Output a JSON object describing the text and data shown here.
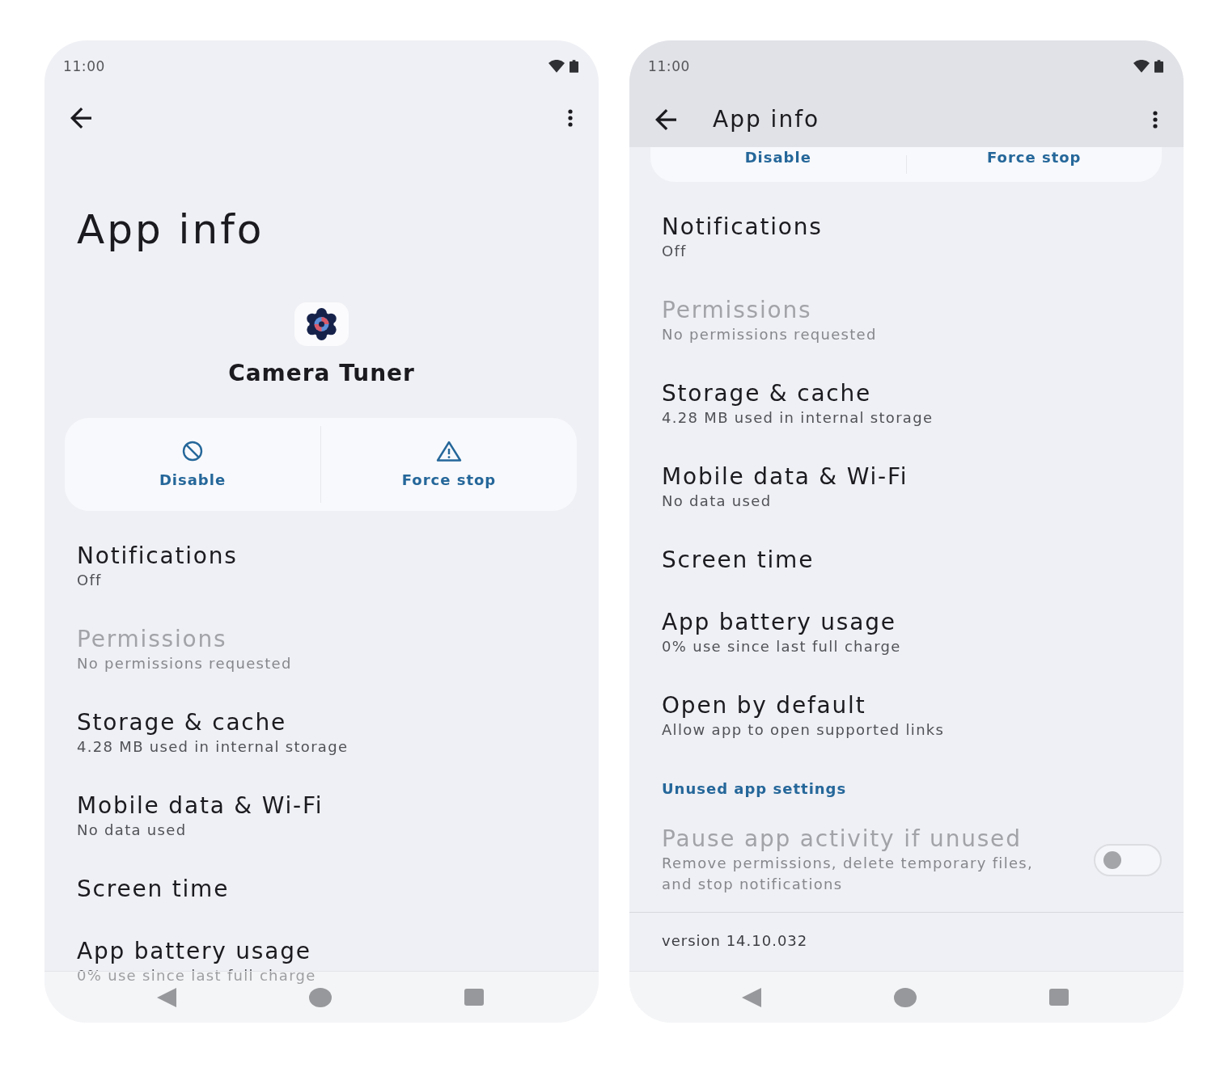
{
  "screens": [
    {
      "status_bar": {
        "time": "11:00"
      },
      "app_bar": {
        "kind": "large",
        "title": "App info"
      },
      "app": {
        "name": "Camera Tuner"
      },
      "actions": [
        {
          "label": "Disable"
        },
        {
          "label": "Force stop"
        }
      ],
      "rows": [
        {
          "kind": "item",
          "title": "Notifications",
          "summary": "Off",
          "disabled": false
        },
        {
          "kind": "item",
          "title": "Permissions",
          "summary": "No permissions requested",
          "disabled": true
        },
        {
          "kind": "item",
          "title": "Storage & cache",
          "summary": "4.28 MB used in internal storage",
          "disabled": false
        },
        {
          "kind": "item",
          "title": "Mobile data & Wi-Fi",
          "summary": "No data used",
          "disabled": false
        },
        {
          "kind": "item",
          "title": "Screen time",
          "disabled": false
        },
        {
          "kind": "item",
          "title": "App battery usage",
          "summary": "0% use since last full charge",
          "disabled": false
        }
      ]
    },
    {
      "status_bar": {
        "time": "11:00"
      },
      "app_bar": {
        "kind": "collapsed",
        "title": "App info"
      },
      "actions": [
        {
          "label": "Disable"
        },
        {
          "label": "Force stop"
        }
      ],
      "rows": [
        {
          "kind": "item",
          "title": "Notifications",
          "summary": "Off",
          "disabled": false
        },
        {
          "kind": "item",
          "title": "Permissions",
          "summary": "No permissions requested",
          "disabled": true
        },
        {
          "kind": "item",
          "title": "Storage & cache",
          "summary": "4.28 MB used in internal storage",
          "disabled": false
        },
        {
          "kind": "item",
          "title": "Mobile data & Wi-Fi",
          "summary": "No data used",
          "disabled": false
        },
        {
          "kind": "item",
          "title": "Screen time",
          "disabled": false
        },
        {
          "kind": "item",
          "title": "App battery usage",
          "summary": "0% use since last full charge",
          "disabled": false
        },
        {
          "kind": "item",
          "title": "Open by default",
          "summary": "Allow app to open supported links",
          "disabled": false
        },
        {
          "kind": "header",
          "title": "Unused app settings",
          "disabled": false
        },
        {
          "kind": "switch",
          "title": "Pause app activity if unused",
          "summary": "Remove permissions, delete temporary files, and stop notifications",
          "disabled": true,
          "on": false
        },
        {
          "kind": "footer",
          "title": "version 14.10.032",
          "disabled": false
        }
      ]
    }
  ]
}
